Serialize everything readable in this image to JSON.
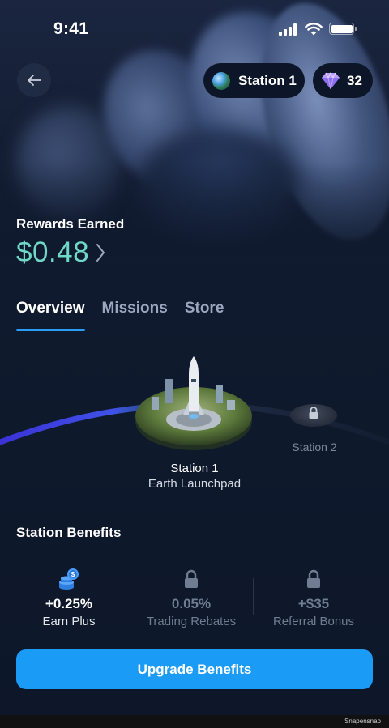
{
  "status_bar": {
    "time": "9:41"
  },
  "header": {
    "station_pill": {
      "icon": "globe-icon",
      "label": "Station 1"
    },
    "gems_pill": {
      "icon": "diamond-icon",
      "count": "32"
    }
  },
  "rewards": {
    "label": "Rewards Earned",
    "value": "$0.48"
  },
  "tabs": [
    {
      "label": "Overview",
      "active": true
    },
    {
      "label": "Missions",
      "active": false
    },
    {
      "label": "Store",
      "active": false
    }
  ],
  "stations": [
    {
      "name": "Station 1",
      "subtitle": "Earth Launchpad",
      "locked": false
    },
    {
      "name": "Station 2",
      "locked": true
    }
  ],
  "benefits": {
    "title": "Station Benefits",
    "items": [
      {
        "value": "+0.25%",
        "label": "Earn Plus",
        "icon": "coins-icon",
        "locked": false
      },
      {
        "value": "0.05%",
        "label": "Trading Rebates",
        "icon": "lock-icon",
        "locked": true
      },
      {
        "value": "+$35",
        "label": "Referral Bonus",
        "icon": "lock-icon",
        "locked": true
      }
    ]
  },
  "cta": {
    "label": "Upgrade Benefits"
  },
  "watermark": "Snapensnap",
  "colors": {
    "accent": "#1a9bf5",
    "reward_value": "#6fd8c7",
    "background": "#0f1a2e"
  }
}
